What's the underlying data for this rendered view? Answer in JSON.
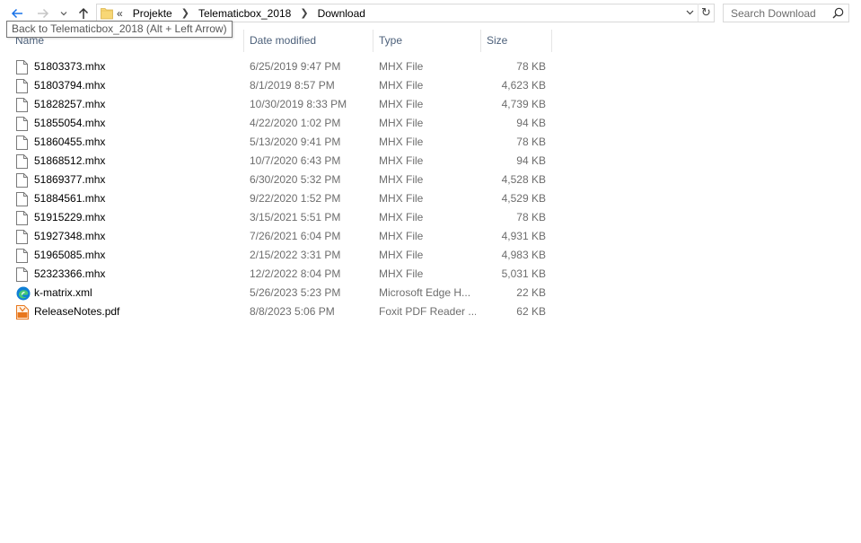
{
  "navigation": {
    "breadcrumb_overflow": "«",
    "breadcrumbs": [
      "Projekte",
      "Telematicbox_2018",
      "Download"
    ],
    "search_placeholder": "Search Download",
    "tooltip": "Back to Telematicbox_2018 (Alt + Left Arrow)"
  },
  "columns": {
    "name": "Name",
    "date": "Date modified",
    "type": "Type",
    "size": "Size"
  },
  "files": [
    {
      "name": "51803373.mhx",
      "date": "6/25/2019 9:47 PM",
      "type": "MHX File",
      "size": "78 KB",
      "icon": "document-icon"
    },
    {
      "name": "51803794.mhx",
      "date": "8/1/2019 8:57 PM",
      "type": "MHX File",
      "size": "4,623 KB",
      "icon": "document-icon"
    },
    {
      "name": "51828257.mhx",
      "date": "10/30/2019 8:33 PM",
      "type": "MHX File",
      "size": "4,739 KB",
      "icon": "document-icon"
    },
    {
      "name": "51855054.mhx",
      "date": "4/22/2020 1:02 PM",
      "type": "MHX File",
      "size": "94 KB",
      "icon": "document-icon"
    },
    {
      "name": "51860455.mhx",
      "date": "5/13/2020 9:41 PM",
      "type": "MHX File",
      "size": "78 KB",
      "icon": "document-icon"
    },
    {
      "name": "51868512.mhx",
      "date": "10/7/2020 6:43 PM",
      "type": "MHX File",
      "size": "94 KB",
      "icon": "document-icon"
    },
    {
      "name": "51869377.mhx",
      "date": "6/30/2020 5:32 PM",
      "type": "MHX File",
      "size": "4,528 KB",
      "icon": "document-icon"
    },
    {
      "name": "51884561.mhx",
      "date": "9/22/2020 1:52 PM",
      "type": "MHX File",
      "size": "4,529 KB",
      "icon": "document-icon"
    },
    {
      "name": "51915229.mhx",
      "date": "3/15/2021 5:51 PM",
      "type": "MHX File",
      "size": "78 KB",
      "icon": "document-icon"
    },
    {
      "name": "51927348.mhx",
      "date": "7/26/2021 6:04 PM",
      "type": "MHX File",
      "size": "4,931 KB",
      "icon": "document-icon"
    },
    {
      "name": "51965085.mhx",
      "date": "2/15/2022 3:31 PM",
      "type": "MHX File",
      "size": "4,983 KB",
      "icon": "document-icon"
    },
    {
      "name": "52323366.mhx",
      "date": "12/2/2022 8:04 PM",
      "type": "MHX File",
      "size": "5,031 KB",
      "icon": "document-icon"
    },
    {
      "name": "k-matrix.xml",
      "date": "5/26/2023 5:23 PM",
      "type": "Microsoft Edge H...",
      "size": "22 KB",
      "icon": "edge-icon"
    },
    {
      "name": "ReleaseNotes.pdf",
      "date": "8/8/2023 5:06 PM",
      "type": "Foxit PDF Reader ...",
      "size": "62 KB",
      "icon": "pdf-icon"
    }
  ],
  "colors": {
    "accent": "#1a73e8",
    "header_text": "#4c607a",
    "secondary_text": "#6d6d6d",
    "folder": "#f8d775",
    "pdf": "#e8771d",
    "edge": "#0f7fd6"
  }
}
